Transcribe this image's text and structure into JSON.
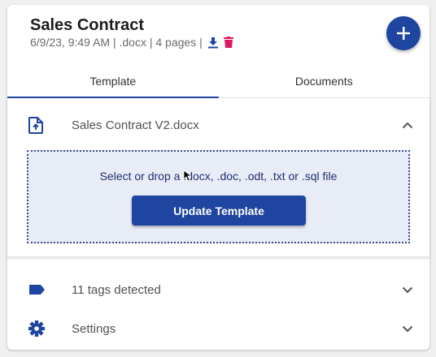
{
  "document": {
    "title": "Sales Contract",
    "meta": "6/9/23, 9:49 AM | .docx | 4 pages |"
  },
  "icons": {
    "download": "download-icon",
    "delete": "trash-icon",
    "add": "plus-icon",
    "file_upload": "file-upload-icon",
    "expand_less": "chevron-up-icon",
    "expand_more": "chevron-down-icon",
    "tag": "label-tag-icon",
    "settings": "gear-icon"
  },
  "tabs": [
    {
      "label": "Template",
      "active": true
    },
    {
      "label": "Documents",
      "active": false
    }
  ],
  "template_panel": {
    "file_name": "Sales Contract V2.docx",
    "expanded": true,
    "dropzone_text": "Select or drop a .docx, .doc, .odt, .txt or .sql file",
    "update_button": "Update Template"
  },
  "sections": {
    "tags": {
      "label": "11 tags detected",
      "expanded": false
    },
    "settings": {
      "label": "Settings",
      "expanded": false
    }
  },
  "colors": {
    "primary": "#1e45a0",
    "delete": "#d81b60",
    "dropzone_bg": "#e8ecf7",
    "dropzone_text": "#1f2f6b"
  }
}
